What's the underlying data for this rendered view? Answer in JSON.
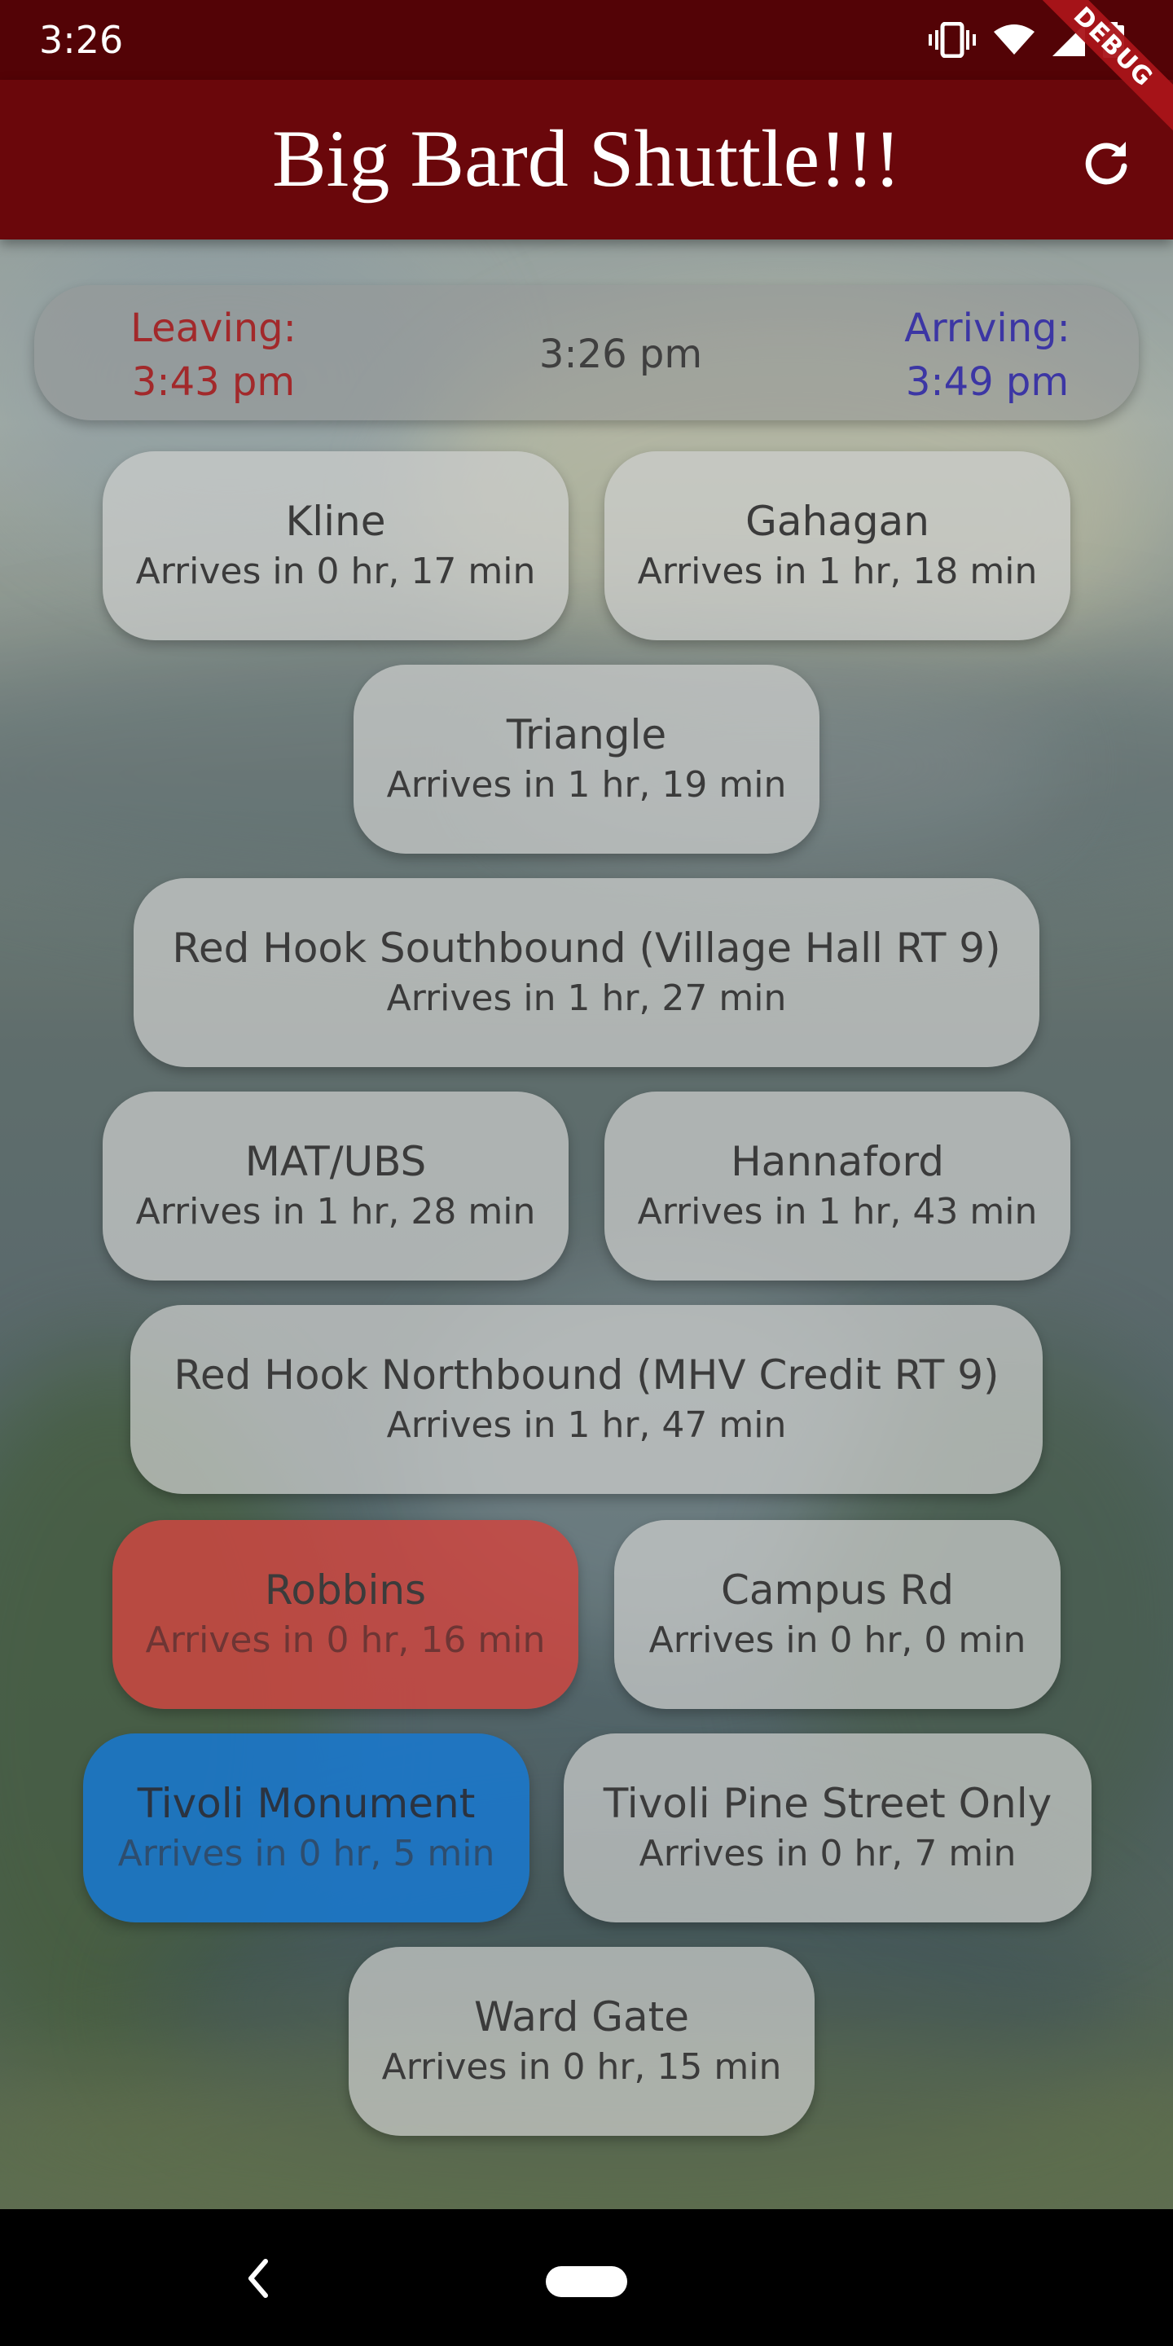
{
  "status_bar": {
    "time": "3:26",
    "icons": [
      "vibrate-icon",
      "wifi-icon",
      "signal-icon",
      "battery-icon"
    ]
  },
  "app_bar": {
    "title": "Big Bard Shuttle!!!",
    "refresh_icon": "refresh-icon",
    "debug_label": "DEBUG"
  },
  "time_card": {
    "leaving_label": "Leaving:",
    "leaving_time": "3:43 pm",
    "current_time": "3:26 pm",
    "arriving_label": "Arriving:",
    "arriving_time": "3:49 pm"
  },
  "stops": [
    {
      "name": "Kline",
      "eta": "Arrives in 0 hr, 17 min",
      "state": "normal"
    },
    {
      "name": "Gahagan",
      "eta": "Arrives in 1 hr, 18 min",
      "state": "normal"
    },
    {
      "name": "Triangle",
      "eta": "Arrives in 1 hr, 19 min",
      "state": "normal"
    },
    {
      "name": "Red Hook Southbound (Village Hall RT 9)",
      "eta": "Arrives in 1 hr, 27 min",
      "state": "normal"
    },
    {
      "name": "MAT/UBS",
      "eta": "Arrives in 1 hr, 28 min",
      "state": "normal"
    },
    {
      "name": "Hannaford",
      "eta": "Arrives in 1 hr, 43 min",
      "state": "normal"
    },
    {
      "name": "Red Hook Northbound (MHV Credit RT 9)",
      "eta": "Arrives in 1 hr, 47 min",
      "state": "normal"
    },
    {
      "name": "Robbins",
      "eta": "Arrives in 0 hr, 16 min",
      "state": "leaving"
    },
    {
      "name": "Campus Rd",
      "eta": "Arrives in 0 hr, 0 min",
      "state": "normal"
    },
    {
      "name": "Tivoli Monument",
      "eta": "Arrives in 0 hr, 5 min",
      "state": "arriving"
    },
    {
      "name": "Tivoli Pine Street Only",
      "eta": "Arrives in 0 hr, 7 min",
      "state": "normal"
    },
    {
      "name": "Ward Gate",
      "eta": "Arrives in 0 hr, 15 min",
      "state": "normal"
    }
  ],
  "colors": {
    "status_bar": "#530306",
    "app_bar": "#6a070b",
    "leaving": "#a2292b",
    "arriving": "#3c36a4",
    "leaving_card": "#cd4641",
    "arriving_card": "#1978cd"
  },
  "nav_bar": {
    "back_icon": "back-icon",
    "home_icon": "home-pill-icon"
  }
}
